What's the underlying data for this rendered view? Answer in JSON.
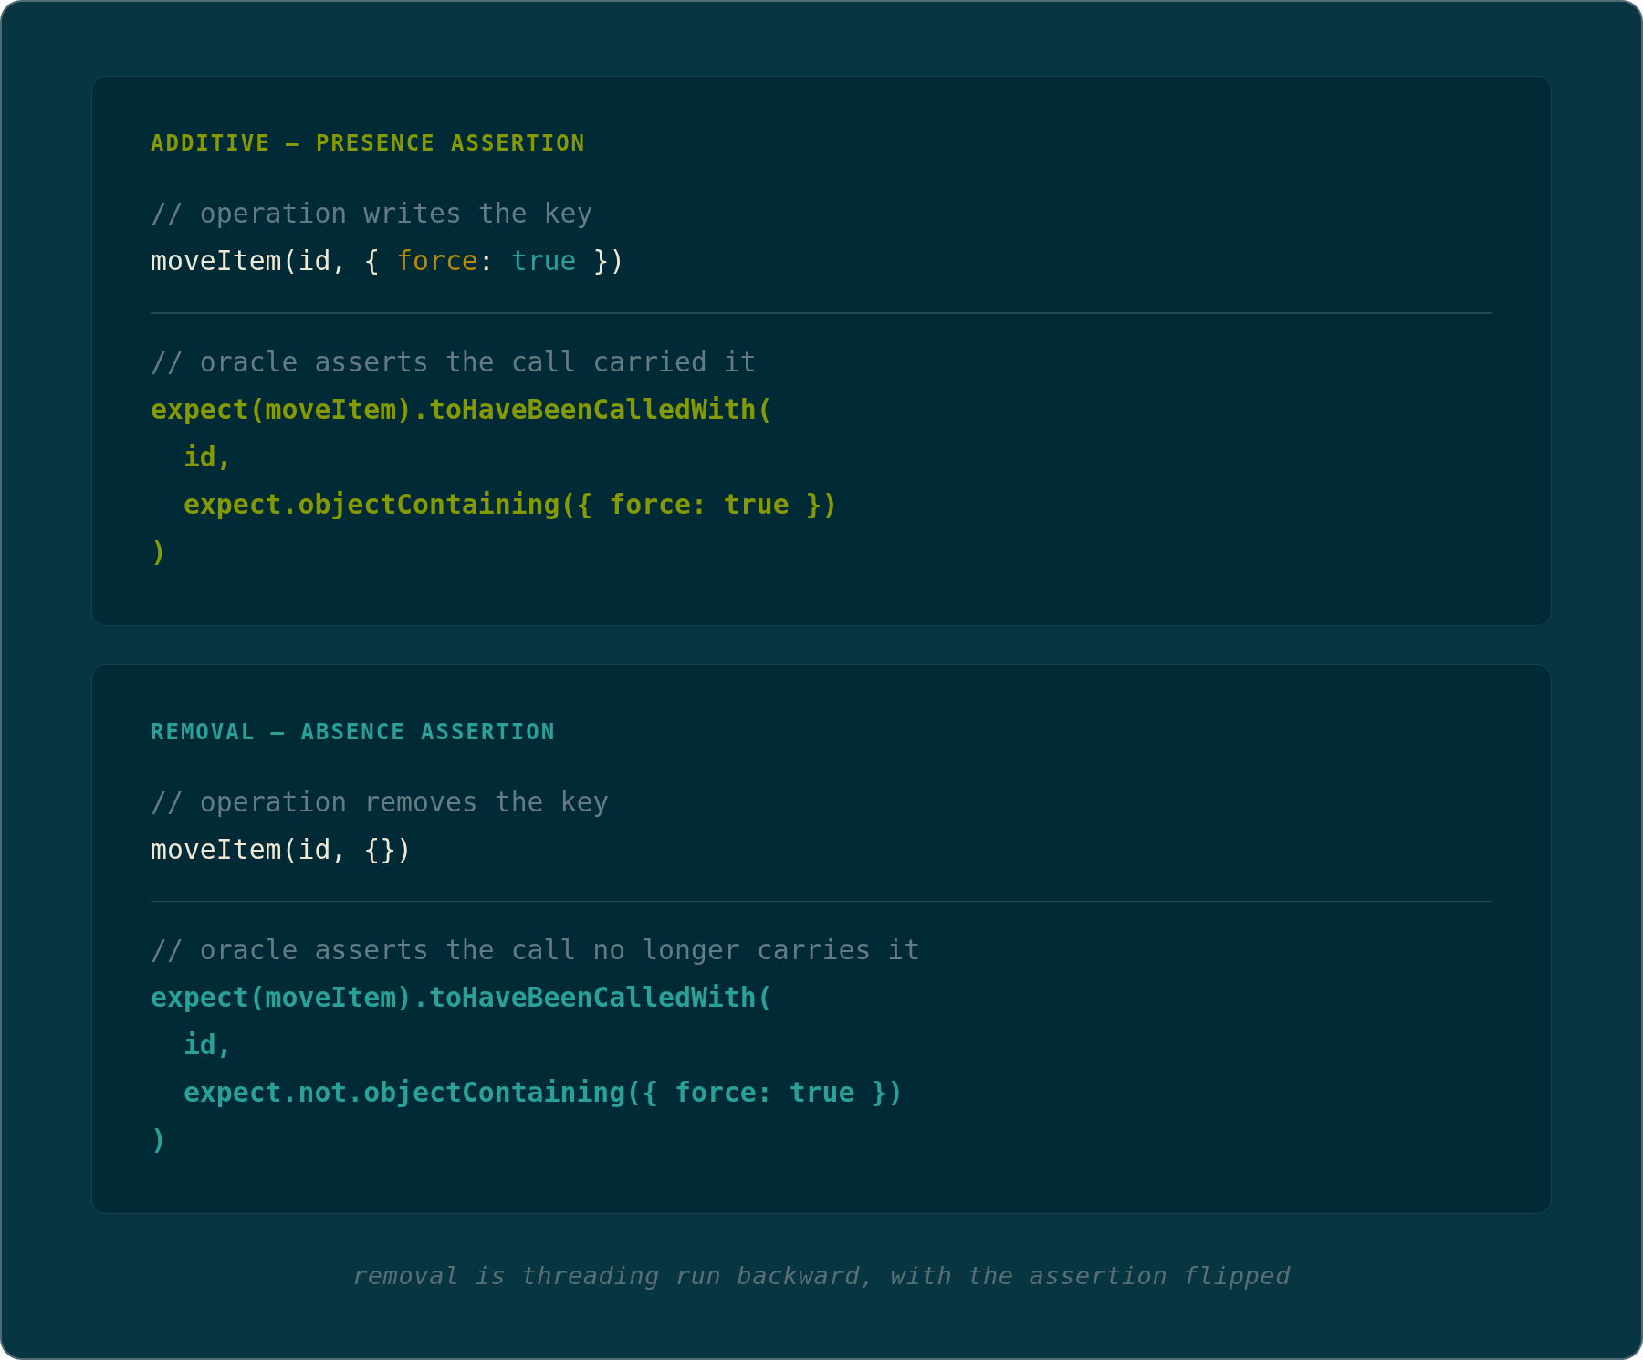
{
  "cards": [
    {
      "heading": "ADDITIVE — PRESENCE ASSERTION",
      "color": "#859900",
      "operation": {
        "comment": "// operation writes the key",
        "tokens": [
          {
            "kind": "plain",
            "text": "moveItem(id, { "
          },
          {
            "kind": "key",
            "text": "force"
          },
          {
            "kind": "plain",
            "text": ": "
          },
          {
            "kind": "bool",
            "text": "true"
          },
          {
            "kind": "plain",
            "text": " })"
          }
        ]
      },
      "assertion": {
        "comment": "// oracle asserts the call carried it",
        "lines": [
          {
            "text": "expect(moveItem).toHaveBeenCalledWith(",
            "indented": false
          },
          {
            "text": "id,",
            "indented": true
          },
          {
            "text": "expect.objectContaining({ force: true })",
            "indented": true
          },
          {
            "text": ")",
            "indented": false
          }
        ]
      }
    },
    {
      "heading": "REMOVAL — ABSENCE ASSERTION",
      "color": "#2aa198",
      "operation": {
        "comment": "// operation removes the key",
        "tokens": [
          {
            "kind": "plain",
            "text": "moveItem(id, {})"
          }
        ]
      },
      "assertion": {
        "comment": "// oracle asserts the call no longer carries it",
        "lines": [
          {
            "text": "expect(moveItem).toHaveBeenCalledWith(",
            "indented": false
          },
          {
            "text": "id,",
            "indented": true
          },
          {
            "text": "expect.not.objectContaining({ force: true })",
            "indented": true
          },
          {
            "text": ")",
            "indented": false
          }
        ]
      }
    }
  ],
  "caption": "removal is threading run backward, with the assertion flipped"
}
